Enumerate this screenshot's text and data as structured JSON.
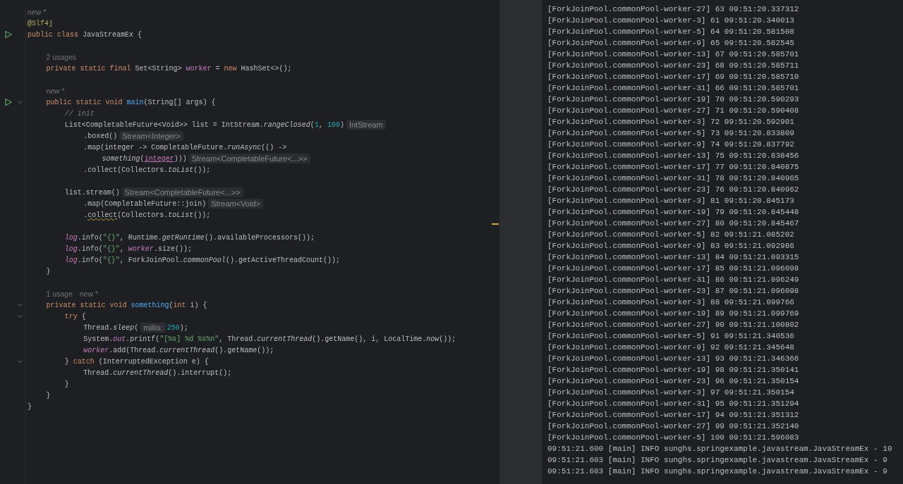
{
  "editor": {
    "lines": [
      {
        "run": false,
        "fold": false,
        "tokens": [
          {
            "kind": "meta",
            "text": "new *"
          }
        ]
      },
      {
        "run": false,
        "fold": false,
        "tokens": [
          {
            "kind": "annot",
            "text": "@Slf4j"
          }
        ]
      },
      {
        "run": true,
        "fold": false,
        "tokens": [
          {
            "kind": "kw",
            "text": "public class "
          },
          {
            "kind": "plain",
            "text": "JavaStreamEx {"
          }
        ],
        "children": [
          {
            "run": false,
            "fold": false
          },
          {
            "run": false,
            "fold": false,
            "tokens": [
              {
                "kind": "meta",
                "text": "2 usages"
              }
            ]
          },
          {
            "run": false,
            "fold": false,
            "tokens": [
              {
                "kind": "kw",
                "text": "private static final "
              },
              {
                "kind": "plain",
                "text": "Set<String> "
              },
              {
                "kind": "field",
                "text": "worker"
              },
              {
                "kind": "plain",
                "text": " = "
              },
              {
                "kind": "kw",
                "text": "new "
              },
              {
                "kind": "plain",
                "text": "HashSet<>();"
              }
            ]
          },
          {
            "run": false,
            "fold": false
          },
          {
            "run": false,
            "fold": false,
            "tokens": [
              {
                "kind": "meta",
                "text": "new *"
              }
            ]
          },
          {
            "run": true,
            "fold": true,
            "tokens": [
              {
                "kind": "kw",
                "text": "public static void "
              },
              {
                "kind": "decl",
                "text": "main"
              },
              {
                "kind": "plain",
                "text": "(String[] args) {"
              }
            ],
            "children": [
              {
                "run": false,
                "fold": false,
                "tokens": [
                  {
                    "kind": "comment",
                    "text": "// init"
                  }
                ]
              },
              {
                "run": false,
                "fold": false,
                "tokens": [
                  {
                    "kind": "plain",
                    "text": "List<CompletableFuture<Void>> list = IntStream."
                  },
                  {
                    "kind": "static",
                    "text": "rangeClosed"
                  },
                  {
                    "kind": "plain",
                    "text": "("
                  },
                  {
                    "kind": "num",
                    "text": "1"
                  },
                  {
                    "kind": "plain",
                    "text": ", "
                  },
                  {
                    "kind": "num",
                    "text": "100"
                  },
                  {
                    "kind": "plain",
                    "text": ")"
                  },
                  {
                    "kind": "inlay",
                    "text": "IntStream"
                  }
                ],
                "children": [
                  {
                    "run": false,
                    "fold": false,
                    "tokens": [
                      {
                        "kind": "plain",
                        "text": ".boxed()"
                      },
                      {
                        "kind": "inlay",
                        "text": "Stream<Integer>"
                      }
                    ]
                  },
                  {
                    "run": false,
                    "fold": false,
                    "tokens": [
                      {
                        "kind": "plain",
                        "text": ".map(integer -> CompletableFuture."
                      },
                      {
                        "kind": "static",
                        "text": "runAsync"
                      },
                      {
                        "kind": "plain",
                        "text": "(() ->"
                      }
                    ],
                    "children": [
                      {
                        "run": false,
                        "fold": false,
                        "tokens": [
                          {
                            "kind": "static",
                            "text": "something"
                          },
                          {
                            "kind": "plain",
                            "text": "("
                          },
                          {
                            "kind": "param",
                            "text": "integer"
                          },
                          {
                            "kind": "plain",
                            "text": ")))"
                          },
                          {
                            "kind": "inlay",
                            "text": "Stream<CompletableFuture<...>>"
                          }
                        ]
                      }
                    ]
                  },
                  {
                    "run": false,
                    "fold": false,
                    "tokens": [
                      {
                        "kind": "plain",
                        "text": ".collect(Collectors."
                      },
                      {
                        "kind": "static",
                        "text": "toList"
                      },
                      {
                        "kind": "plain",
                        "text": "());"
                      }
                    ]
                  }
                ]
              },
              {
                "run": false,
                "fold": false
              },
              {
                "run": false,
                "fold": false,
                "tokens": [
                  {
                    "kind": "plain",
                    "text": "list.stream()"
                  },
                  {
                    "kind": "inlay",
                    "text": "Stream<CompletableFuture<...>>"
                  }
                ],
                "children": [
                  {
                    "run": false,
                    "fold": false,
                    "tokens": [
                      {
                        "kind": "plain",
                        "text": ".map(CompletableFuture::join)"
                      },
                      {
                        "kind": "inlay",
                        "text": "Stream<Void>"
                      }
                    ]
                  },
                  {
                    "run": false,
                    "fold": false,
                    "tokens": [
                      {
                        "kind": "plain",
                        "text": "."
                      },
                      {
                        "kind": "warn",
                        "text": "collect"
                      },
                      {
                        "kind": "plain",
                        "text": "(Collectors."
                      },
                      {
                        "kind": "static",
                        "text": "toList"
                      },
                      {
                        "kind": "plain",
                        "text": "());"
                      }
                    ]
                  }
                ]
              },
              {
                "run": false,
                "fold": false
              },
              {
                "run": false,
                "fold": false,
                "tokens": [
                  {
                    "kind": "fieldi",
                    "text": "log"
                  },
                  {
                    "kind": "plain",
                    "text": ".info("
                  },
                  {
                    "kind": "str",
                    "text": "\"{}\""
                  },
                  {
                    "kind": "plain",
                    "text": ", Runtime."
                  },
                  {
                    "kind": "static",
                    "text": "getRuntime"
                  },
                  {
                    "kind": "plain",
                    "text": "().availableProcessors());"
                  }
                ]
              },
              {
                "run": false,
                "fold": false,
                "tokens": [
                  {
                    "kind": "fieldi",
                    "text": "log"
                  },
                  {
                    "kind": "plain",
                    "text": ".info("
                  },
                  {
                    "kind": "str",
                    "text": "\"{}\""
                  },
                  {
                    "kind": "plain",
                    "text": ", "
                  },
                  {
                    "kind": "fieldi",
                    "text": "worker"
                  },
                  {
                    "kind": "plain",
                    "text": ".size());"
                  }
                ]
              },
              {
                "run": false,
                "fold": false,
                "tokens": [
                  {
                    "kind": "fieldi",
                    "text": "log"
                  },
                  {
                    "kind": "plain",
                    "text": ".info("
                  },
                  {
                    "kind": "str",
                    "text": "\"{}\""
                  },
                  {
                    "kind": "plain",
                    "text": ", ForkJoinPool."
                  },
                  {
                    "kind": "static",
                    "text": "commonPool"
                  },
                  {
                    "kind": "plain",
                    "text": "().getActiveThreadCount());"
                  }
                ]
              }
            ]
          },
          {
            "run": false,
            "fold": false,
            "tokens": [
              {
                "kind": "plain",
                "text": "}"
              }
            ]
          },
          {
            "run": false,
            "fold": false
          },
          {
            "run": false,
            "fold": false,
            "tokens": [
              {
                "kind": "meta",
                "text": "1 usage"
              },
              {
                "kind": "meta",
                "text": "new *"
              }
            ]
          },
          {
            "run": false,
            "fold": true,
            "tokens": [
              {
                "kind": "kw",
                "text": "private static void "
              },
              {
                "kind": "decl",
                "text": "something"
              },
              {
                "kind": "plain",
                "text": "("
              },
              {
                "kind": "kw",
                "text": "int "
              },
              {
                "kind": "plain",
                "text": "i) {"
              }
            ],
            "children": [
              {
                "run": false,
                "fold": true,
                "tokens": [
                  {
                    "kind": "kw",
                    "text": "try "
                  },
                  {
                    "kind": "plain",
                    "text": "{"
                  }
                ],
                "children": [
                  {
                    "run": false,
                    "fold": false,
                    "tokens": [
                      {
                        "kind": "plain",
                        "text": "Thread."
                      },
                      {
                        "kind": "static",
                        "text": "sleep"
                      },
                      {
                        "kind": "plain",
                        "text": "("
                      },
                      {
                        "kind": "inlay",
                        "text": "millis:"
                      },
                      {
                        "kind": "num",
                        "text": "250"
                      },
                      {
                        "kind": "plain",
                        "text": ");"
                      }
                    ]
                  },
                  {
                    "run": false,
                    "fold": false,
                    "tokens": [
                      {
                        "kind": "plain",
                        "text": "System."
                      },
                      {
                        "kind": "fieldi",
                        "text": "out"
                      },
                      {
                        "kind": "plain",
                        "text": ".printf("
                      },
                      {
                        "kind": "str",
                        "text": "\"[%s] %d %s%n\""
                      },
                      {
                        "kind": "plain",
                        "text": ", Thread."
                      },
                      {
                        "kind": "static",
                        "text": "currentThread"
                      },
                      {
                        "kind": "plain",
                        "text": "().getName(), i, LocalTime."
                      },
                      {
                        "kind": "static",
                        "text": "now"
                      },
                      {
                        "kind": "plain",
                        "text": "());"
                      }
                    ]
                  },
                  {
                    "run": false,
                    "fold": false,
                    "tokens": [
                      {
                        "kind": "fieldi",
                        "text": "worker"
                      },
                      {
                        "kind": "plain",
                        "text": ".add(Thread."
                      },
                      {
                        "kind": "static",
                        "text": "currentThread"
                      },
                      {
                        "kind": "plain",
                        "text": "().getName());"
                      }
                    ]
                  }
                ]
              },
              {
                "run": false,
                "fold": true,
                "tokens": [
                  {
                    "kind": "plain",
                    "text": "} "
                  },
                  {
                    "kind": "kw",
                    "text": "catch "
                  },
                  {
                    "kind": "plain",
                    "text": "(InterruptedException e) {"
                  }
                ],
                "children": [
                  {
                    "run": false,
                    "fold": false,
                    "tokens": [
                      {
                        "kind": "plain",
                        "text": "Thread."
                      },
                      {
                        "kind": "static",
                        "text": "currentThread"
                      },
                      {
                        "kind": "plain",
                        "text": "().interrupt();"
                      }
                    ]
                  }
                ]
              },
              {
                "run": false,
                "fold": false,
                "tokens": [
                  {
                    "kind": "plain",
                    "text": "}"
                  }
                ]
              }
            ]
          },
          {
            "run": false,
            "fold": false,
            "tokens": [
              {
                "kind": "plain",
                "text": "}"
              }
            ]
          }
        ]
      },
      {
        "run": false,
        "fold": false,
        "tokens": [
          {
            "kind": "plain",
            "text": "}"
          }
        ]
      }
    ]
  },
  "console": {
    "lines": [
      "[ForkJoinPool.commonPool-worker-27] 63 09:51:20.337312",
      "[ForkJoinPool.commonPool-worker-3] 61 09:51:20.340013",
      "[ForkJoinPool.commonPool-worker-5] 64 09:51:20.581508",
      "[ForkJoinPool.commonPool-worker-9] 65 09:51:20.582545",
      "[ForkJoinPool.commonPool-worker-13] 67 09:51:20.585701",
      "[ForkJoinPool.commonPool-worker-23] 68 09:51:20.585711",
      "[ForkJoinPool.commonPool-worker-17] 69 09:51:20.585710",
      "[ForkJoinPool.commonPool-worker-31] 66 09:51:20.585701",
      "[ForkJoinPool.commonPool-worker-19] 70 09:51:20.590293",
      "[ForkJoinPool.commonPool-worker-27] 71 09:51:20.590408",
      "[ForkJoinPool.commonPool-worker-3] 72 09:51:20.592901",
      "[ForkJoinPool.commonPool-worker-5] 73 09:51:20.833809",
      "[ForkJoinPool.commonPool-worker-9] 74 09:51:20.837792",
      "[ForkJoinPool.commonPool-worker-13] 75 09:51:20.838456",
      "[ForkJoinPool.commonPool-worker-17] 77 09:51:20.840875",
      "[ForkJoinPool.commonPool-worker-31] 78 09:51:20.840965",
      "[ForkJoinPool.commonPool-worker-23] 76 09:51:20.840962",
      "[ForkJoinPool.commonPool-worker-3] 81 09:51:20.845173",
      "[ForkJoinPool.commonPool-worker-19] 79 09:51:20.845448",
      "[ForkJoinPool.commonPool-worker-27] 80 09:51:20.845467",
      "[ForkJoinPool.commonPool-worker-5] 82 09:51:21.085202",
      "[ForkJoinPool.commonPool-worker-9] 83 09:51:21.092986",
      "[ForkJoinPool.commonPool-worker-13] 84 09:51:21.093315",
      "[ForkJoinPool.commonPool-worker-17] 85 09:51:21.096098",
      "[ForkJoinPool.commonPool-worker-31] 86 09:51:21.096249",
      "[ForkJoinPool.commonPool-worker-23] 87 09:51:21.096098",
      "[ForkJoinPool.commonPool-worker-3] 88 09:51:21.099766",
      "[ForkJoinPool.commonPool-worker-19] 89 09:51:21.099769",
      "[ForkJoinPool.commonPool-worker-27] 90 09:51:21.100802",
      "[ForkJoinPool.commonPool-worker-5] 91 09:51:21.340536",
      "[ForkJoinPool.commonPool-worker-9] 92 09:51:21.345648",
      "[ForkJoinPool.commonPool-worker-13] 93 09:51:21.346366",
      "[ForkJoinPool.commonPool-worker-19] 98 09:51:21.350141",
      "[ForkJoinPool.commonPool-worker-23] 96 09:51:21.350154",
      "[ForkJoinPool.commonPool-worker-3] 97 09:51:21.350154",
      "[ForkJoinPool.commonPool-worker-31] 95 09:51:21.351294",
      "[ForkJoinPool.commonPool-worker-17] 94 09:51:21.351312",
      "[ForkJoinPool.commonPool-worker-27] 99 09:51:21.352140",
      "[ForkJoinPool.commonPool-worker-5] 100 09:51:21.596083",
      "09:51:21.600 [main] INFO sunghs.springexample.javastream.JavaStreamEx - 10",
      "09:51:21.603 [main] INFO sunghs.springexample.javastream.JavaStreamEx - 9",
      "09:51:21.603 [main] INFO sunghs.springexample.javastream.JavaStreamEx - 9"
    ]
  }
}
